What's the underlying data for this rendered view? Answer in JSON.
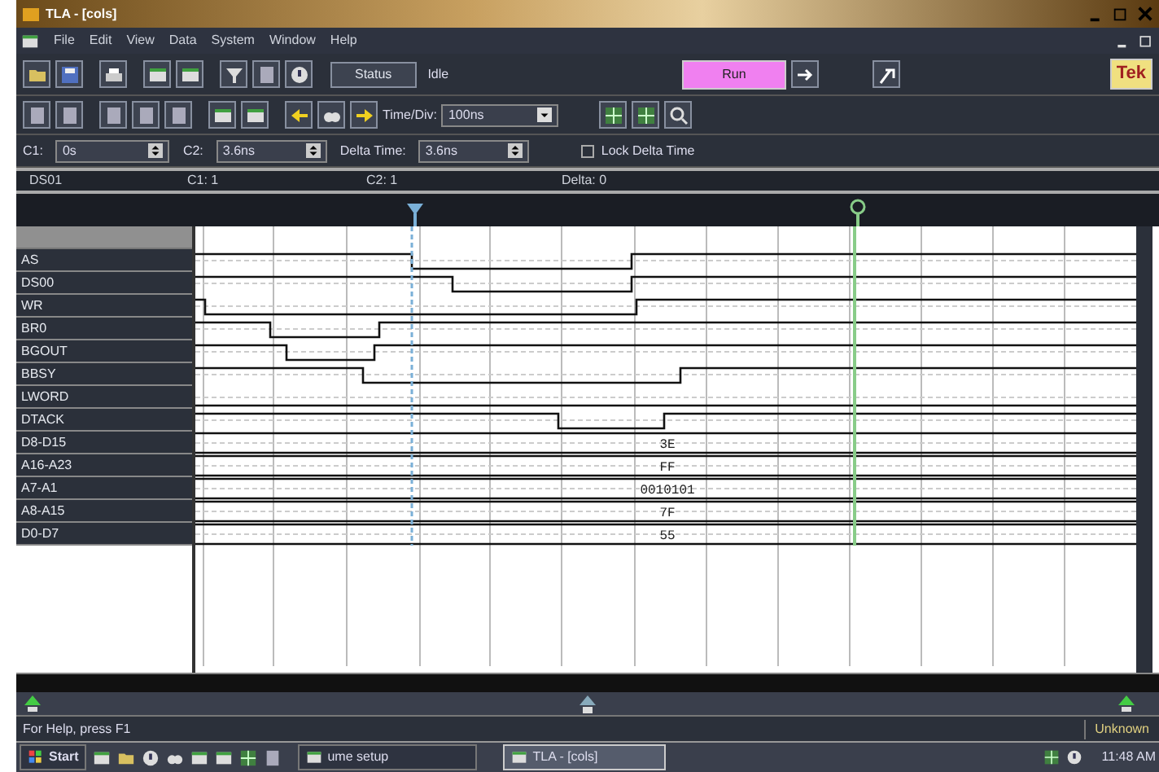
{
  "window": {
    "title": "TLA - [cols]"
  },
  "menu": [
    "File",
    "Edit",
    "View",
    "Data",
    "System",
    "Window",
    "Help"
  ],
  "toolbar": {
    "status_button": "Status",
    "status_text": "Idle",
    "run_button": "Run",
    "logo": "Tek",
    "time_div_label": "Time/Div:",
    "time_div_value": "100ns"
  },
  "cursors": {
    "c1_label": "C1:",
    "c1_value": "0s",
    "c2_label": "C2:",
    "c2_value": "3.6ns",
    "delta_label": "Delta Time:",
    "delta_value": "3.6ns",
    "lock_label": "Lock Delta Time",
    "lock_checked": false
  },
  "info_bar": [
    "DS01",
    "C1: 1",
    "C2: 1",
    "Delta: 0"
  ],
  "signals": [
    {
      "name": "AS",
      "kind": "line"
    },
    {
      "name": "DS00",
      "kind": "line"
    },
    {
      "name": "WR",
      "kind": "line"
    },
    {
      "name": "BR0",
      "kind": "line"
    },
    {
      "name": "BGOUT",
      "kind": "line"
    },
    {
      "name": "BBSY",
      "kind": "line"
    },
    {
      "name": "LWORD",
      "kind": "line"
    },
    {
      "name": "DTACK",
      "kind": "line"
    },
    {
      "name": "D8-D15",
      "kind": "bus",
      "value": "3E"
    },
    {
      "name": "A16-A23",
      "kind": "bus",
      "value": "FF"
    },
    {
      "name": "A7-A1",
      "kind": "bus",
      "value": "0010101"
    },
    {
      "name": "A8-A15",
      "kind": "bus",
      "value": "7F"
    },
    {
      "name": "D0-D7",
      "kind": "bus",
      "value": "55"
    }
  ],
  "status_bar": {
    "help": "For Help, press F1",
    "indicator": "Unknown"
  },
  "taskbar": {
    "start": "Start",
    "tasks": [
      {
        "label": "ume setup",
        "selected": false
      },
      {
        "label": "TLA - [cols]",
        "selected": true
      }
    ],
    "clock": "11:48 AM"
  }
}
